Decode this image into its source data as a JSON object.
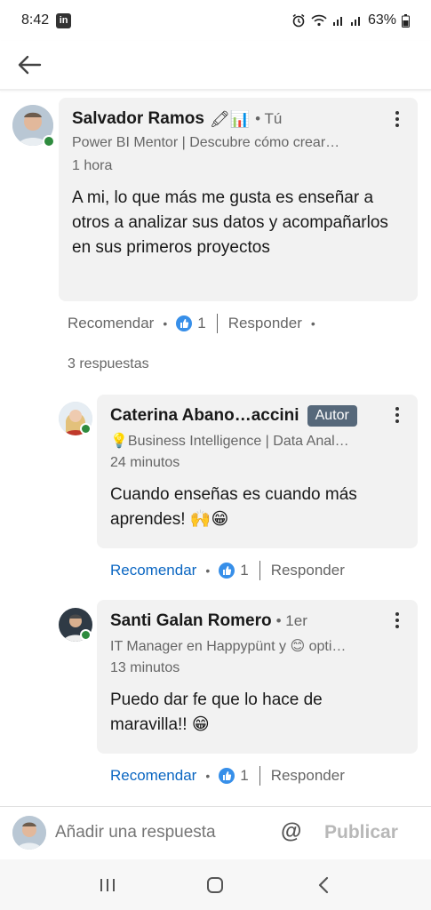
{
  "status_bar": {
    "time": "8:42",
    "app_badge": "in",
    "battery": "63%"
  },
  "comment": {
    "author": "Salvador Ramos",
    "author_emojis": "🖍📊",
    "you_label": "• Tú",
    "headline": "Power BI Mentor | Descubre cómo crear…",
    "time": "1 hora",
    "body": "A mi, lo que más me gusta es enseñar a otros a analizar sus datos y acompañarlos en sus primeros proyectos",
    "actions": {
      "like": "Recomendar",
      "like_count": "1",
      "reply": "Responder"
    }
  },
  "replies_count": "3 respuestas",
  "replies": [
    {
      "author": "Caterina Abano…accini",
      "badge": "Autor",
      "headline": "💡Business Intelligence | Data Anal…",
      "time": "24 minutos",
      "body": "Cuando enseñas es cuando más aprendes! 🙌😁",
      "actions": {
        "like": "Recomendar",
        "like_count": "1",
        "reply": "Responder"
      }
    },
    {
      "author": "Santi Galan Romero",
      "degree": "• 1er",
      "headline": "IT Manager en Happypünt y 😊 opti…",
      "time": "13 minutos",
      "body": "Puedo dar fe que lo hace de maravilla!! 😁",
      "actions": {
        "like": "Recomendar",
        "like_count": "1",
        "reply": "Responder"
      }
    }
  ],
  "composer": {
    "placeholder": "Añadir una respuesta",
    "mention": "@",
    "publish": "Publicar"
  },
  "colors": {
    "link_blue": "#0a66c2",
    "like_blue": "#378fe9",
    "badge_gray": "#56687a",
    "online_green": "#2e8b3e"
  }
}
